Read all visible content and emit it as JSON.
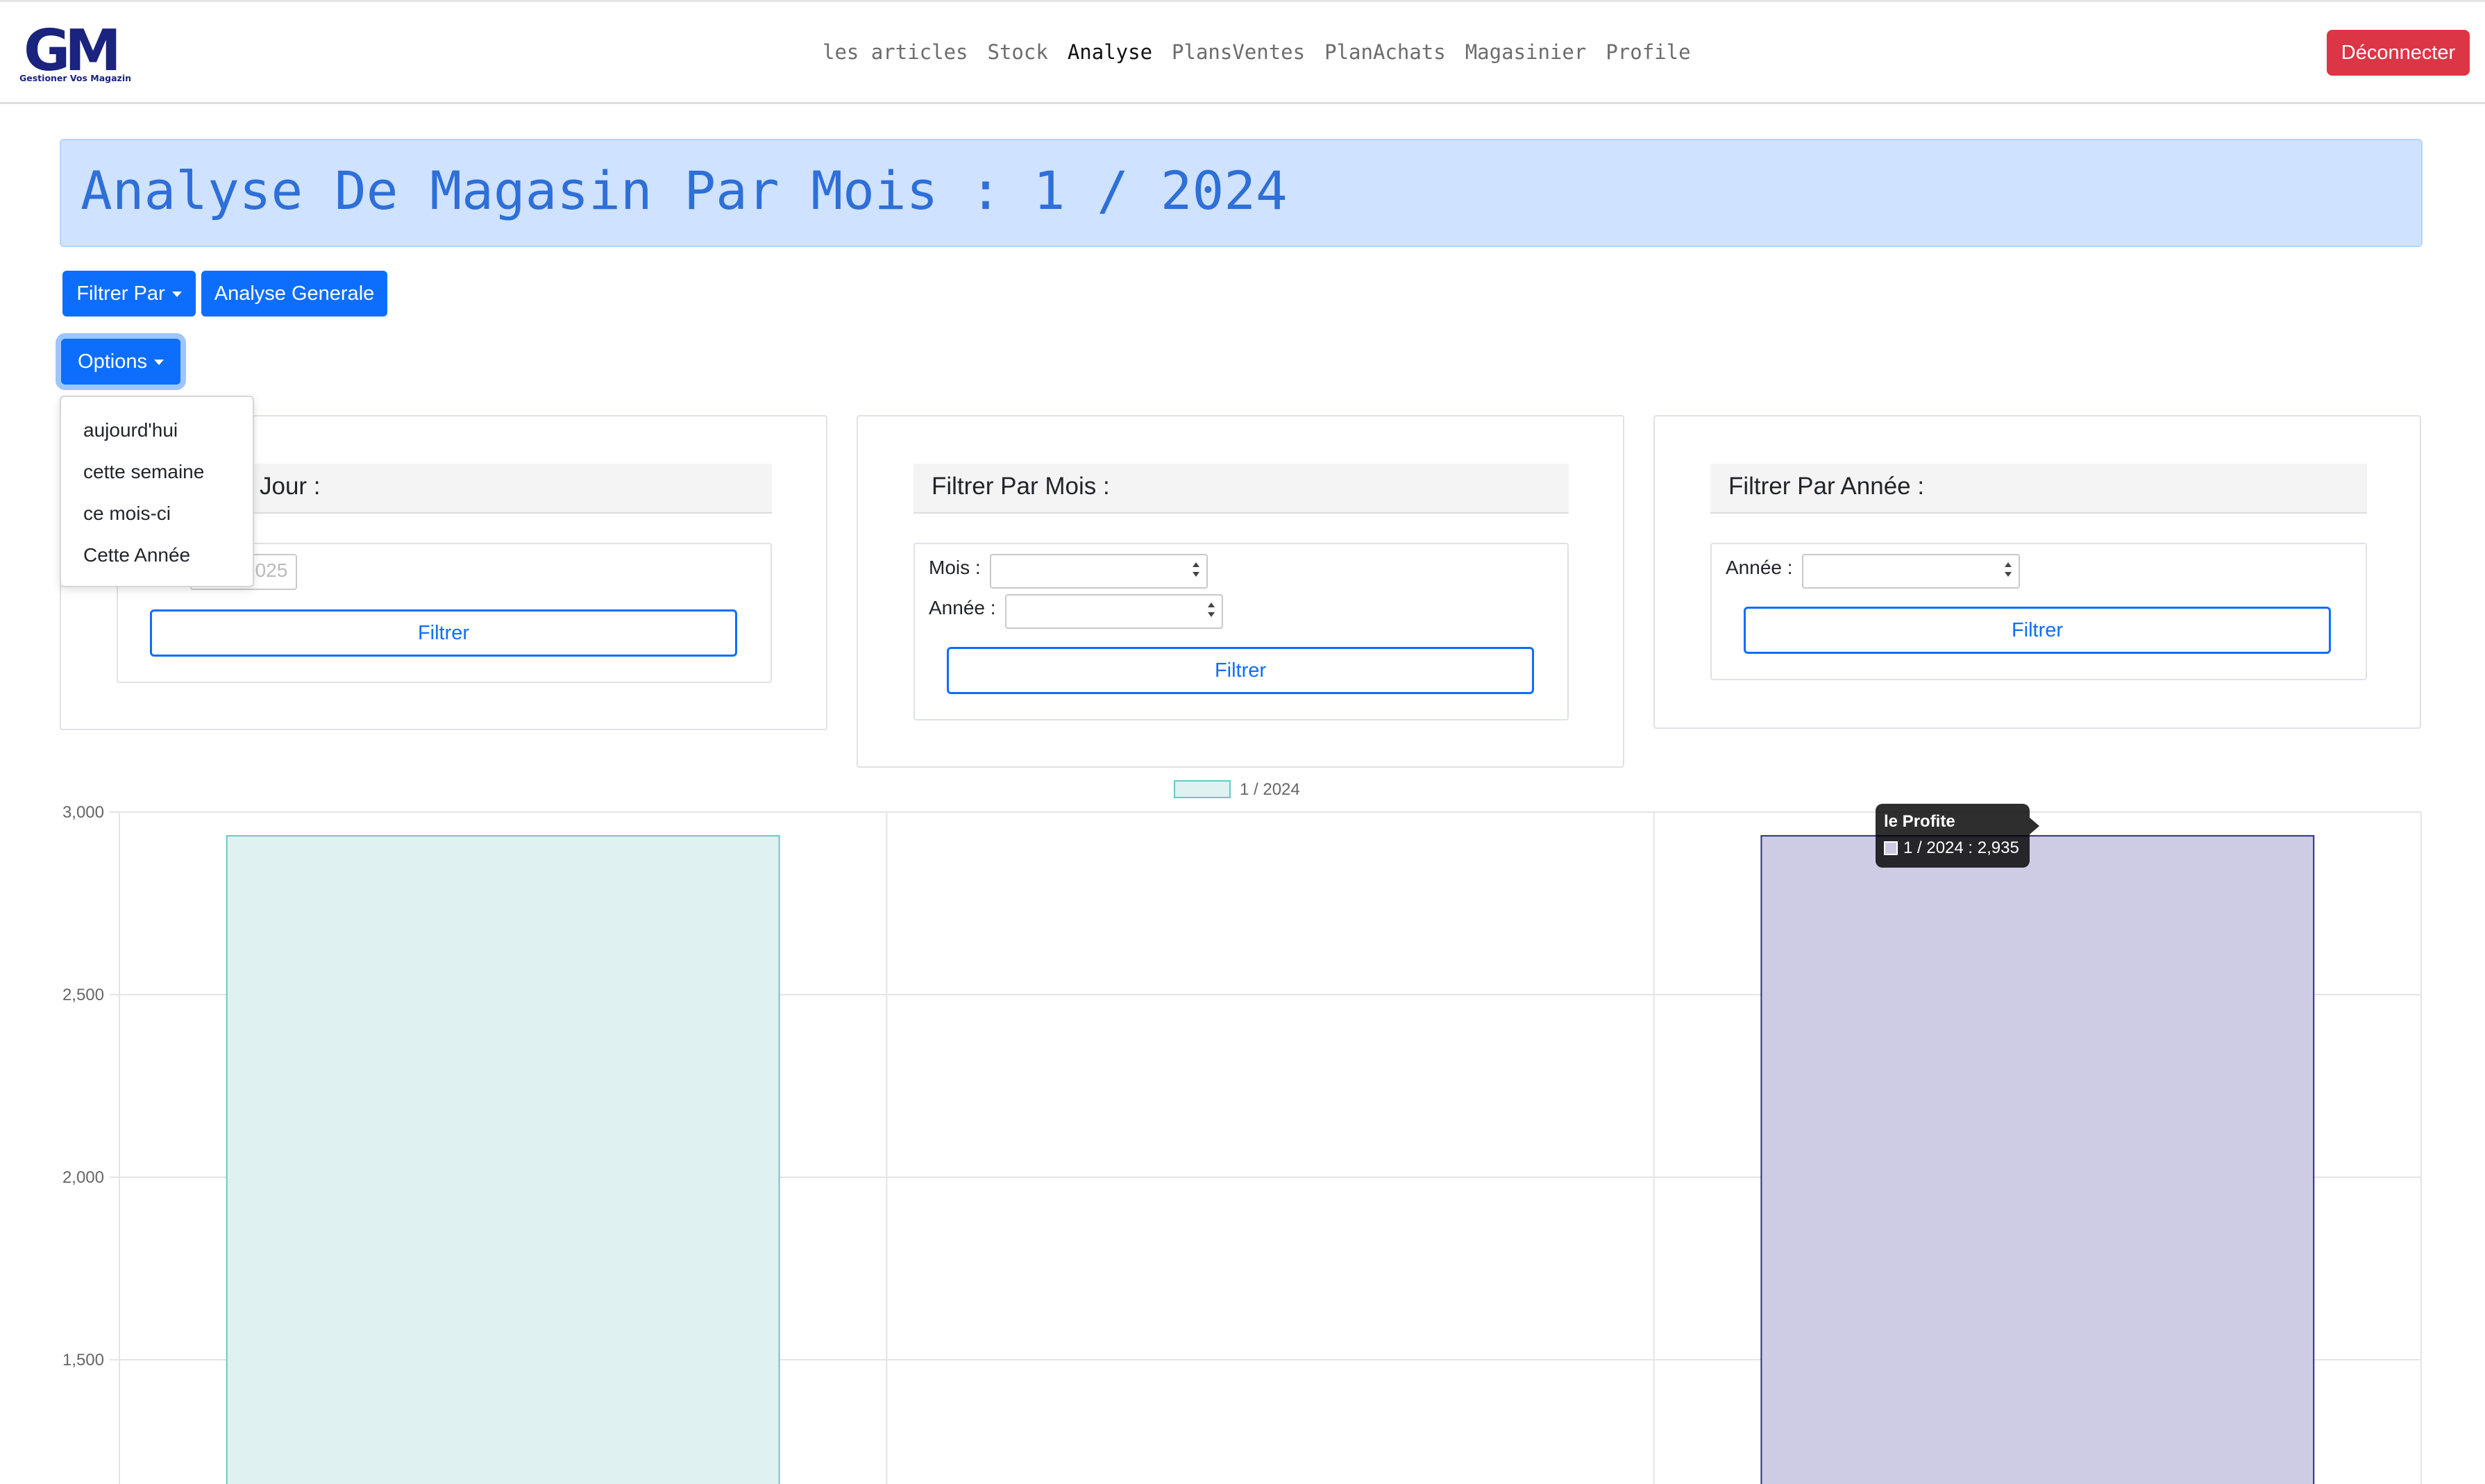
{
  "navbar": {
    "logo_text": "GM",
    "logo_subtitle": "Gestioner Vos Magazin",
    "links": [
      {
        "label": "les articles",
        "active": false
      },
      {
        "label": "Stock",
        "active": false
      },
      {
        "label": "Analyse",
        "active": true
      },
      {
        "label": "PlansVentes",
        "active": false
      },
      {
        "label": "PlanAchats",
        "active": false
      },
      {
        "label": "Magasinier",
        "active": false
      },
      {
        "label": "Profile",
        "active": false
      }
    ],
    "logout_label": "Déconnecter"
  },
  "page_title": "Analyse De Magasin Par Mois : 1 / 2024",
  "toolbar": {
    "filter_by_label": "Filtrer Par",
    "general_analysis_label": "Analyse Generale",
    "options_label": "Options"
  },
  "options_menu": {
    "items": [
      "aujourd'hui",
      "cette semaine",
      "ce mois-ci",
      "Cette Année"
    ]
  },
  "filters": {
    "day": {
      "header": "Filtrer Par Jour :",
      "header_visible": "Jour :",
      "date_value": "2025",
      "button": "Filtrer"
    },
    "month": {
      "header": "Filtrer Par Mois :",
      "month_label": "Mois :",
      "year_label": "Année :",
      "button": "Filtrer"
    },
    "year": {
      "header": "Filtrer Par Année :",
      "year_label": "Année :",
      "button": "Filtrer"
    }
  },
  "tooltip": {
    "title": "le Profite",
    "body": "1 / 2024 : 2,935"
  },
  "colors": {
    "primary": "#0d6efd",
    "danger": "#dc3545",
    "banner_bg": "#cfe2ff",
    "banner_text": "#2e6fd8",
    "bar1_fill": "#e0f1f1",
    "bar1_stroke": "#6cc6c6",
    "bar3_fill": "#cecce5",
    "bar3_stroke": "#2b2d8a"
  },
  "chart_data": {
    "type": "bar",
    "categories": [
      "",
      "",
      "le Profite"
    ],
    "series": [
      {
        "name": "1 / 2024",
        "values": [
          2935,
          null,
          2935
        ]
      }
    ],
    "legend": "top-center",
    "y_ticks": [
      3000,
      2500,
      2000,
      1500
    ],
    "y_tick_labels": [
      "3,000",
      "2,500",
      "2,000",
      "1,500"
    ],
    "ylim": [
      1200,
      3000
    ],
    "grid": true
  }
}
